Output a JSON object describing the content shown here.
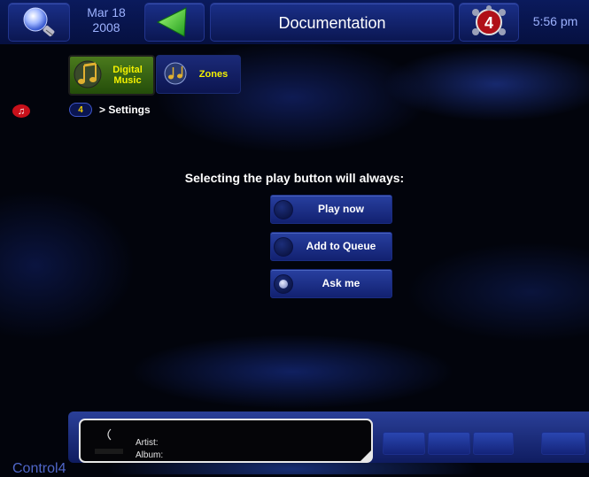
{
  "header": {
    "date_month_day": "Mar 18",
    "date_year": "2008",
    "title": "Documentation",
    "time": "5:56 pm",
    "logo_text": "4"
  },
  "tabs": [
    {
      "label_line1": "Digital",
      "label_line2": "Music",
      "active": true
    },
    {
      "label_line1": "Zones",
      "label_line2": "",
      "active": false
    }
  ],
  "breadcrumb": {
    "back_label": "4",
    "path": "> Settings"
  },
  "settings": {
    "question": "Selecting the play button will always:",
    "options": [
      {
        "label": "Play now",
        "selected": false
      },
      {
        "label": "Add to Queue",
        "selected": false
      },
      {
        "label": "Ask me",
        "selected": true
      }
    ]
  },
  "now_playing": {
    "artist_label": "Artist:",
    "album_label": "Album:"
  },
  "brand": {
    "text": "Control4"
  },
  "colors": {
    "accent_blue": "#1a2f88",
    "active_tab_green": "#4b7a1d",
    "tab_text_yellow": "#f4f100",
    "date_text": "#9db2ff",
    "music_badge_red": "#c8101a"
  }
}
